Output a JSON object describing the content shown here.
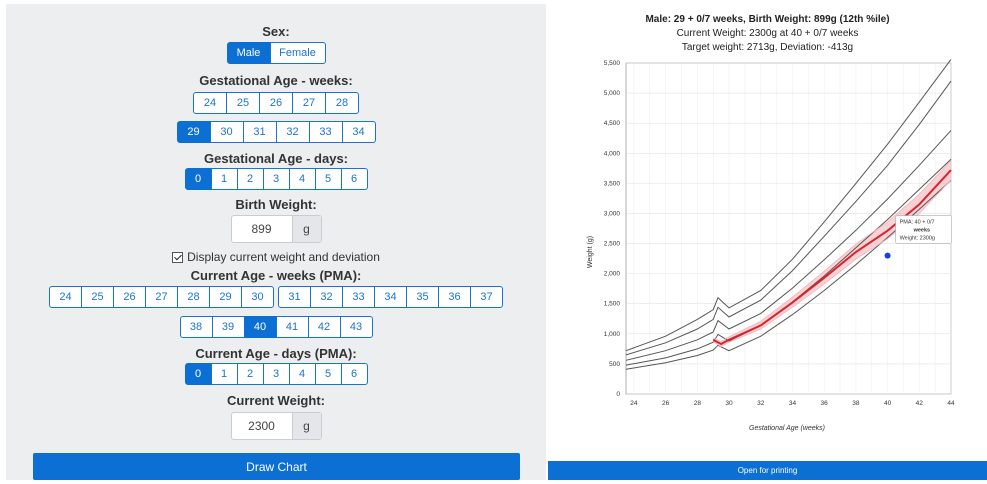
{
  "form": {
    "sex": {
      "label": "Sex:",
      "options": [
        "Male",
        "Female"
      ],
      "selected": "Male"
    },
    "ga_weeks": {
      "label": "Gestational Age - weeks:",
      "row1": [
        "24",
        "25",
        "26",
        "27",
        "28"
      ],
      "row2": [
        "29",
        "30",
        "31",
        "32",
        "33",
        "34"
      ],
      "selected": "29"
    },
    "ga_days": {
      "label": "Gestational Age - days:",
      "options": [
        "0",
        "1",
        "2",
        "3",
        "4",
        "5",
        "6"
      ],
      "selected": "0"
    },
    "birth_weight": {
      "label": "Birth Weight:",
      "value": "899",
      "unit": "g"
    },
    "display_current": {
      "label": "Display current weight and deviation",
      "checked": true
    },
    "pma_weeks": {
      "label": "Current Age - weeks (PMA):",
      "row1a": [
        "24",
        "25",
        "26",
        "27",
        "28",
        "29",
        "30"
      ],
      "row1b": [
        "31",
        "32",
        "33",
        "34",
        "35",
        "36",
        "37"
      ],
      "row2": [
        "38",
        "39",
        "40",
        "41",
        "42",
        "43"
      ],
      "selected": "40"
    },
    "pma_days": {
      "label": "Current Age - days (PMA):",
      "options": [
        "0",
        "1",
        "2",
        "3",
        "4",
        "5",
        "6"
      ],
      "selected": "0"
    },
    "current_weight": {
      "label": "Current Weight:",
      "value": "2300",
      "unit": "g"
    },
    "draw_button": "Draw Chart"
  },
  "chart_panel": {
    "title": "Male: 29 + 0/7 weeks, Birth Weight: 899g (12th %ile)",
    "line2": "Current Weight: 2300g at 40 + 0/7 weeks",
    "line3": "Target weight: 2713g, Deviation: -413g",
    "print_button": "Open for printing",
    "tooltip": {
      "pma_label": "PMA:",
      "pma_value": "40 + 0/7",
      "pma_unit": "weeks",
      "weight_label": "Weight:",
      "weight_value": "2300g"
    }
  },
  "chart_data": {
    "type": "line",
    "xlabel": "Gestational Age (weeks)",
    "ylabel": "Weight (g)",
    "xlim": [
      23.5,
      44
    ],
    "ylim": [
      0,
      5500
    ],
    "xticks": [
      24,
      26,
      28,
      30,
      32,
      34,
      36,
      38,
      40,
      42,
      44
    ],
    "yticks": [
      0,
      500,
      1000,
      1500,
      2000,
      2500,
      3000,
      3500,
      4000,
      4500,
      5000,
      5500
    ],
    "grid": true,
    "colors": {
      "percentile": "#555555",
      "patient": "#d9232d",
      "band": "#f4b4b9",
      "point": "#1a3ee6"
    },
    "percentile_series": [
      {
        "x": [
          23.5,
          26,
          28,
          29,
          29.3,
          30,
          32,
          34,
          36,
          38,
          40,
          42,
          44
        ],
        "values": [
          720,
          960,
          1240,
          1400,
          1600,
          1430,
          1720,
          2240,
          2860,
          3500,
          4150,
          4850,
          5560
        ]
      },
      {
        "x": [
          23.5,
          26,
          28,
          29,
          29.3,
          30,
          32,
          34,
          36,
          38,
          40,
          42,
          44
        ],
        "values": [
          650,
          850,
          1080,
          1240,
          1440,
          1280,
          1560,
          2050,
          2620,
          3200,
          3800,
          4480,
          5200
        ]
      },
      {
        "x": [
          23.5,
          26,
          28,
          29,
          29.3,
          30,
          32,
          34,
          36,
          38,
          40,
          42,
          44
        ],
        "values": [
          560,
          720,
          900,
          1030,
          1220,
          1080,
          1340,
          1760,
          2230,
          2720,
          3240,
          3800,
          4380
        ]
      },
      {
        "x": [
          23.5,
          26,
          28,
          29,
          29.3,
          30,
          32,
          34,
          36,
          38,
          40,
          42,
          44
        ],
        "values": [
          480,
          600,
          750,
          860,
          990,
          880,
          1140,
          1530,
          1960,
          2430,
          2900,
          3400,
          3900
        ]
      },
      {
        "x": [
          23.5,
          26,
          28,
          29,
          29.3,
          30,
          32,
          34,
          36,
          38,
          40,
          42,
          44
        ],
        "values": [
          410,
          520,
          640,
          730,
          810,
          720,
          960,
          1320,
          1720,
          2150,
          2600,
          3070,
          3550
        ]
      }
    ],
    "patient_series": {
      "x": [
        29,
        29.5,
        30,
        32,
        34,
        36,
        38,
        40,
        42,
        44
      ],
      "values": [
        899,
        830,
        900,
        1140,
        1520,
        1930,
        2360,
        2713,
        3150,
        3720
      ]
    },
    "band_upper": {
      "x": [
        29,
        29.5,
        30,
        32,
        34,
        36,
        38,
        40,
        42,
        44
      ],
      "values": [
        930,
        870,
        950,
        1210,
        1610,
        2040,
        2490,
        2860,
        3320,
        3880
      ]
    },
    "band_lower": {
      "x": [
        29,
        29.5,
        30,
        32,
        34,
        36,
        38,
        40,
        42,
        44
      ],
      "values": [
        870,
        790,
        860,
        1080,
        1440,
        1830,
        2240,
        2580,
        3000,
        3560
      ]
    },
    "points": [
      {
        "x": 40,
        "y": 2300
      }
    ]
  }
}
